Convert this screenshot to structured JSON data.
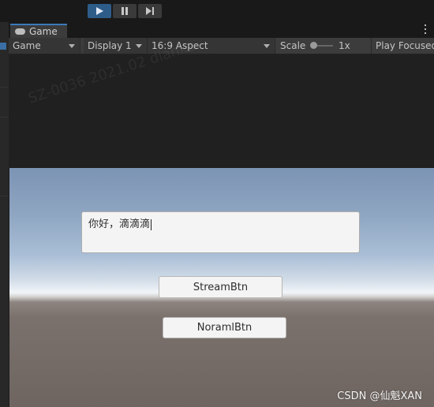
{
  "toolbar": {
    "play_icon": "play-icon",
    "pause_icon": "pause-icon",
    "step_icon": "step-icon"
  },
  "game_window": {
    "tab_label": "Game",
    "tab_icon": "gamepad-icon",
    "menu_icon": "more-vertical-icon",
    "view_dropdown": "Game",
    "display_dropdown": "Display 1",
    "aspect_dropdown": "16:9 Aspect",
    "scale_label": "Scale",
    "scale_value": "1x",
    "play_focused_label": "Play Focused"
  },
  "scene": {
    "input_text": "你好，滴滴滴",
    "stream_button": "StreamBtn",
    "noram_button": "NoramlBtn"
  },
  "watermark": "CSDN @仙魁XAN",
  "colors": {
    "accent": "#3a79bb",
    "play_active": "#2e5c89"
  }
}
